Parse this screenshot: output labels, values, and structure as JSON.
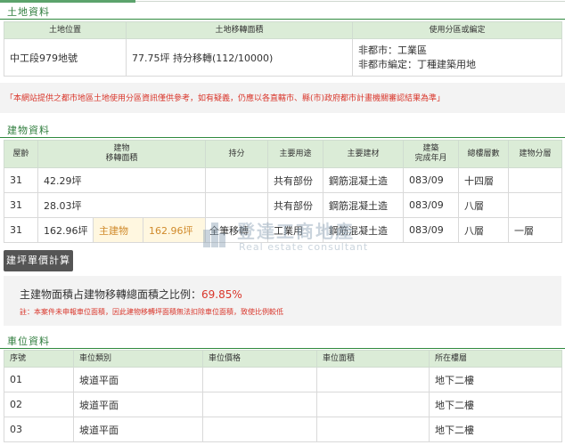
{
  "land_section": {
    "title": "土地資料",
    "headers": [
      "土地位置",
      "土地移轉面積",
      "使用分區或編定"
    ],
    "rows": [
      {
        "location": "中工段979地號",
        "area": "77.75坪 持分移轉(112/10000)",
        "zoning_line1": "非都市：工業區",
        "zoning_line2": "非都市編定：丁種建築用地"
      }
    ]
  },
  "notice": {
    "text": "「本網站提供之都市地區土地使用分區資訊僅供參考，如有疑義，仍應以各直轄市、縣(市)政府都市計畫機關審認結果為準」"
  },
  "building_section": {
    "title": "建物資料",
    "headers": {
      "age": "屋齡",
      "area_line1": "建物",
      "area_line2": "移轉面積",
      "share": "持分",
      "usage": "主要用途",
      "material": "主要建材",
      "completed_line1": "建築",
      "completed_line2": "完成年月",
      "total_floors": "總樓層數",
      "floor": "建物分層"
    },
    "rows": [
      {
        "age": "31",
        "area": "42.29坪",
        "sub_label": "",
        "sub_area": "",
        "share": "",
        "usage": "共有部份",
        "material": "鋼筋混凝土造",
        "completed": "083/09",
        "total_floors": "十四層",
        "floor": ""
      },
      {
        "age": "31",
        "area": "28.03坪",
        "sub_label": "",
        "sub_area": "",
        "share": "",
        "usage": "共有部份",
        "material": "鋼筋混凝土造",
        "completed": "083/09",
        "total_floors": "八層",
        "floor": ""
      },
      {
        "age": "31",
        "area": "162.96坪",
        "sub_label": "主建物",
        "sub_area": "162.96坪",
        "share": "全筆移轉",
        "usage": "工業用",
        "material": "鋼筋混凝土造",
        "completed": "083/09",
        "total_floors": "八層",
        "floor": "一層"
      }
    ]
  },
  "calc_button": {
    "label": "建坪單價計算"
  },
  "ratio": {
    "label": "主建物面積占建物移轉總面積之比例：",
    "value": "69.85%",
    "note": "註：本案件未申報車位面積，因此建物移轉坪面積無法扣除車位面積，致使比例較低"
  },
  "parking_section": {
    "title": "車位資料",
    "headers": [
      "序號",
      "車位類別",
      "車位價格",
      "車位面積",
      "所在樓層"
    ],
    "rows": [
      {
        "no": "01",
        "type": "坡道平面",
        "price": "",
        "area": "",
        "floor": "地下二樓"
      },
      {
        "no": "02",
        "type": "坡道平面",
        "price": "",
        "area": "",
        "floor": "地下二樓"
      },
      {
        "no": "03",
        "type": "坡道平面",
        "price": "",
        "area": "",
        "floor": "地下二樓"
      }
    ]
  },
  "watermark": {
    "main": "登達工商地產",
    "sub": "Real estate consultant"
  },
  "colors": {
    "accent_green": "#2f8a3e",
    "header_bg": "#dbecd7",
    "red": "#d9362b",
    "highlight": "#fff7e0"
  }
}
